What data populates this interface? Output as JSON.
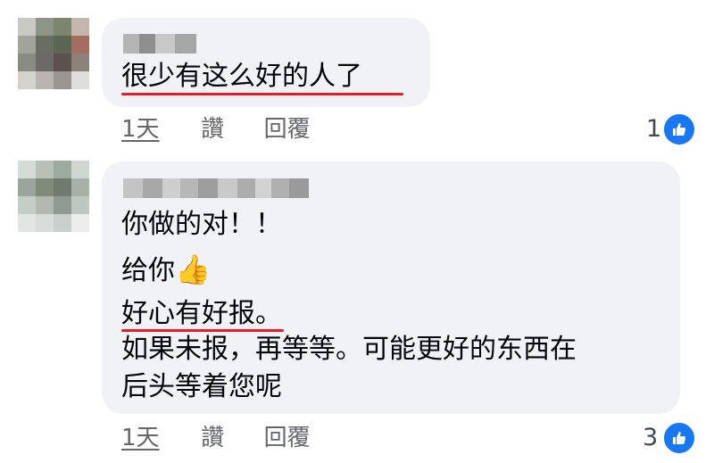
{
  "comments": [
    {
      "lines": [
        "很少有这么好的人了"
      ],
      "meta": {
        "time": "1天",
        "like": "讚",
        "reply": "回覆"
      },
      "reaction_count": "1",
      "reaction_icon": "thumbs-up-icon"
    },
    {
      "lines": [
        "你做的对！！",
        "给你",
        "好心有好报。",
        "如果未报，再等等。可能更好的东西在",
        "后头等着您呢"
      ],
      "emoji": "👍",
      "meta": {
        "time": "1天",
        "like": "讚",
        "reply": "回覆"
      },
      "reaction_count": "3",
      "reaction_icon": "thumbs-up-icon"
    }
  ],
  "colors": {
    "bubble": "#f0f2f5",
    "underline": "#e41e26",
    "like_badge": "#1877f2",
    "meta_text": "#65676b"
  }
}
